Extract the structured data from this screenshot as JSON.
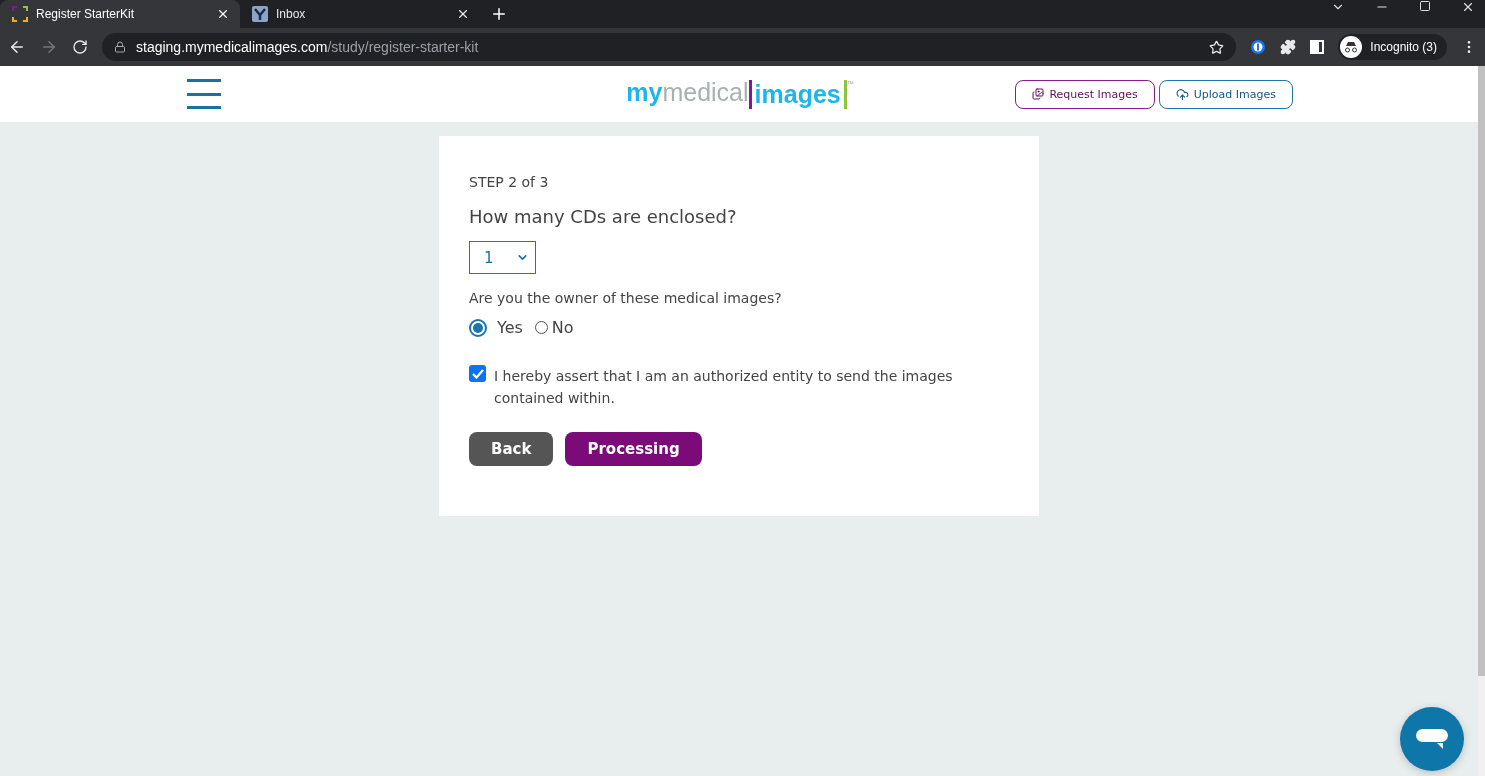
{
  "browser": {
    "tabs": [
      {
        "title": "Register StarterKit",
        "selected": true
      },
      {
        "title": "Inbox",
        "selected": false
      }
    ],
    "address": {
      "domain": "staging.mymedicalimages.com",
      "path": "/study/register-starter-kit"
    },
    "profile": "Incognito (3)"
  },
  "header": {
    "logo": {
      "part_1": "my",
      "part_2": "medical",
      "part_3": "images",
      "trademark": "™"
    },
    "buttons": [
      {
        "label": "Request Images",
        "kind": "request"
      },
      {
        "label": "Upload Images",
        "kind": "upload"
      }
    ]
  },
  "form": {
    "step": "STEP 2 of 3",
    "question": "How many CDs are enclosed?",
    "select": {
      "value": "1"
    },
    "owner_question": "Are you the owner of these medical images?",
    "options": [
      {
        "label": "Yes",
        "selected": true
      },
      {
        "label": "No",
        "selected": false
      }
    ],
    "consent": {
      "text": "I hereby assert that I am an authorized entity to send the images contained within.",
      "checked": true
    },
    "buttons": [
      {
        "label": "Back",
        "kind": "secondary"
      },
      {
        "label": "Processing",
        "kind": "primary"
      }
    ]
  }
}
